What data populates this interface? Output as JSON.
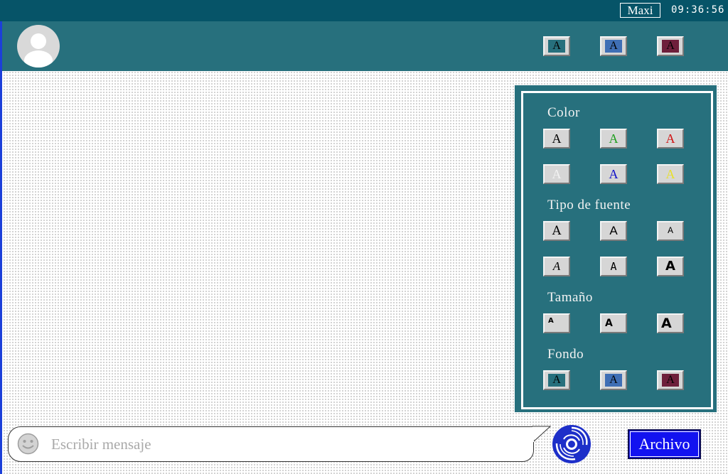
{
  "status_bar": {
    "username": "Maxi",
    "time": "09:36:56"
  },
  "header": {
    "background_buttons": [
      {
        "label": "A",
        "icon": "background-teal-icon",
        "bg": "#27707d"
      },
      {
        "label": "A",
        "icon": "background-blue-icon",
        "bg": "#3f6fb5"
      },
      {
        "label": "A",
        "icon": "background-maroon-icon",
        "bg": "#6e1f3b"
      }
    ]
  },
  "style_panel": {
    "color_title": "Color",
    "color_buttons": [
      {
        "label": "A",
        "color": "#000000"
      },
      {
        "label": "A",
        "color": "#1f9e1f"
      },
      {
        "label": "A",
        "color": "#d11414"
      },
      {
        "label": "A",
        "color": "#f2f2f2"
      },
      {
        "label": "A",
        "color": "#1010c8"
      },
      {
        "label": "A",
        "color": "#e8e02a"
      }
    ],
    "font_title": "Tipo de fuente",
    "font_buttons": [
      {
        "label": "A",
        "font": "serif"
      },
      {
        "label": "A",
        "font": "sans"
      },
      {
        "label": "A",
        "font": "mono-thin"
      },
      {
        "label": "A",
        "font": "script"
      },
      {
        "label": "A",
        "font": "mono"
      },
      {
        "label": "A",
        "font": "sans-bold"
      }
    ],
    "size_title": "Tamaño",
    "size_buttons": [
      {
        "label": "A",
        "size": "small"
      },
      {
        "label": "A",
        "size": "medium"
      },
      {
        "label": "A",
        "size": "large"
      }
    ],
    "background_title": "Fondo",
    "background_buttons": [
      {
        "label": "A",
        "bg": "#27707d"
      },
      {
        "label": "A",
        "bg": "#3f6fb5"
      },
      {
        "label": "A",
        "bg": "#6e1f3b"
      }
    ]
  },
  "composer": {
    "placeholder": "Escribir mensaje",
    "file_button_label": "Archivo",
    "emoji_icon": "smiley-icon",
    "logo_icon": "swirl-logo-icon"
  }
}
